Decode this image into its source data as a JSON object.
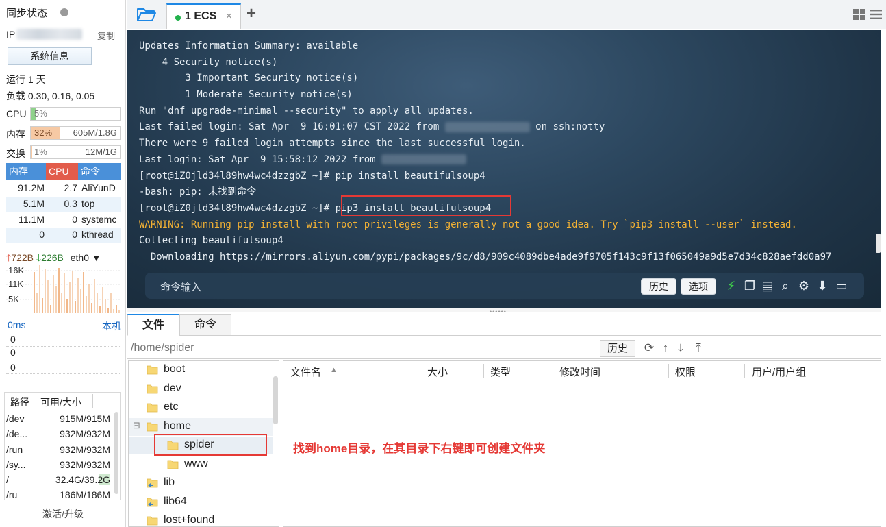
{
  "sidebar": {
    "sync_title": "同步状态",
    "ip_label": "IP",
    "copy_label": "复制",
    "sysinfo_label": "系统信息",
    "uptime": "运行 1 天",
    "load": "负载 0.30, 0.16, 0.05",
    "cpu": {
      "label": "CPU",
      "pct": "5%",
      "fraction": 0.05
    },
    "mem": {
      "label": "内存",
      "pct": "32%",
      "value": "605M/1.8G",
      "fraction": 0.32
    },
    "swap": {
      "label": "交换",
      "pct": "1%",
      "value": "12M/1G",
      "fraction": 0.01
    },
    "proc_headers": [
      "内存",
      "CPU",
      "命令"
    ],
    "processes": [
      {
        "mem": "91.2M",
        "cpu": "2.7",
        "cmd": "AliYunD"
      },
      {
        "mem": "5.1M",
        "cpu": "0.3",
        "cmd": "top"
      },
      {
        "mem": "11.1M",
        "cpu": "0",
        "cmd": "systemc"
      },
      {
        "mem": "0",
        "cpu": "0",
        "cmd": "kthread"
      }
    ],
    "net": {
      "up": "722B",
      "down": "226B",
      "iface": "eth0",
      "ticks": [
        "16K",
        "11K",
        "5K"
      ]
    },
    "ping": {
      "ms": "0ms",
      "local": "本机",
      "values": [
        "0",
        "0",
        "0"
      ]
    },
    "disk_headers": [
      "路径",
      "可用/大小"
    ],
    "disks": [
      {
        "path": "/dev",
        "size": "915M/915M"
      },
      {
        "path": "/de...",
        "size": "932M/932M"
      },
      {
        "path": "/run",
        "size": "932M/932M"
      },
      {
        "path": "/sy...",
        "size": "932M/932M"
      },
      {
        "path": "/",
        "size": "32.4G/39.2G"
      },
      {
        "path": "/ru",
        "size": "186M/186M"
      }
    ],
    "activate_label": "激活/升级"
  },
  "tabbar": {
    "tab_label": "1 ECS",
    "close_glyph": "×",
    "add_glyph": "+"
  },
  "terminal": {
    "lines": [
      {
        "text": "Updates Information Summary: available",
        "style": "normal"
      },
      {
        "text": "    4 Security notice(s)",
        "style": "normal"
      },
      {
        "text": "        3 Important Security notice(s)",
        "style": "normal"
      },
      {
        "text": "        1 Moderate Security notice(s)",
        "style": "normal"
      },
      {
        "text": "Run \"dnf upgrade-minimal --security\" to apply all updates.",
        "style": "normal"
      },
      {
        "text": "Last failed login: Sat Apr  9 16:01:07 CST 2022 from ",
        "style": "normal",
        "blur": true,
        "after": " on ssh:notty"
      },
      {
        "text": "There were 9 failed login attempts since the last successful login.",
        "style": "normal"
      },
      {
        "text": "Last login: Sat Apr  9 15:58:12 2022 from ",
        "style": "normal",
        "blur": true,
        "after": ""
      },
      {
        "text": "[root@iZ0jld34l89hw4wc4dzzgbZ ~]# pip install beautifulsoup4",
        "style": "normal"
      },
      {
        "text": "-bash: pip: 未找到命令",
        "style": "normal"
      },
      {
        "text": "[root@iZ0jld34l89hw4wc4dzzgbZ ~]# pip3 install beautifulsoup4",
        "style": "normal"
      },
      {
        "text": "WARNING: Running pip install with root privileges is generally not a good idea. Try `pip3 install --user` instead.",
        "style": "warn"
      },
      {
        "text": "Collecting beautifulsoup4",
        "style": "normal"
      },
      {
        "text": "  Downloading https://mirrors.aliyun.com/pypi/packages/9c/d8/909c4089dbe4ade9f9705f143c9f13f065049a9d5e7d34c828aefdd0a97",
        "style": "normal"
      }
    ],
    "cmd_placeholder": "命令输入",
    "history_label": "历史",
    "options_label": "选项"
  },
  "file_panel": {
    "tab_files": "文件",
    "tab_commands": "命令",
    "path": "/home/spider",
    "history_label": "历史",
    "tree": [
      {
        "label": "boot",
        "depth": 0
      },
      {
        "label": "dev",
        "depth": 0
      },
      {
        "label": "etc",
        "depth": 0
      },
      {
        "label": "home",
        "depth": 0,
        "expanded": true
      },
      {
        "label": "spider",
        "depth": 1
      },
      {
        "label": "www",
        "depth": 1
      },
      {
        "label": "lib",
        "depth": 0,
        "link": true
      },
      {
        "label": "lib64",
        "depth": 0,
        "link": true
      },
      {
        "label": "lost+found",
        "depth": 0
      }
    ],
    "columns": [
      "文件名",
      "大小",
      "类型",
      "修改时间",
      "权限",
      "用户/用户组"
    ],
    "annotation": "找到home目录，在其目录下右键即可创建文件夹"
  },
  "colors": {
    "accent": "#1e88e5",
    "annotation_red": "#e53935",
    "warning_yellow": "#f2b134",
    "proc_header_blue": "#4a90d9",
    "proc_header_red": "#e25c4b"
  }
}
